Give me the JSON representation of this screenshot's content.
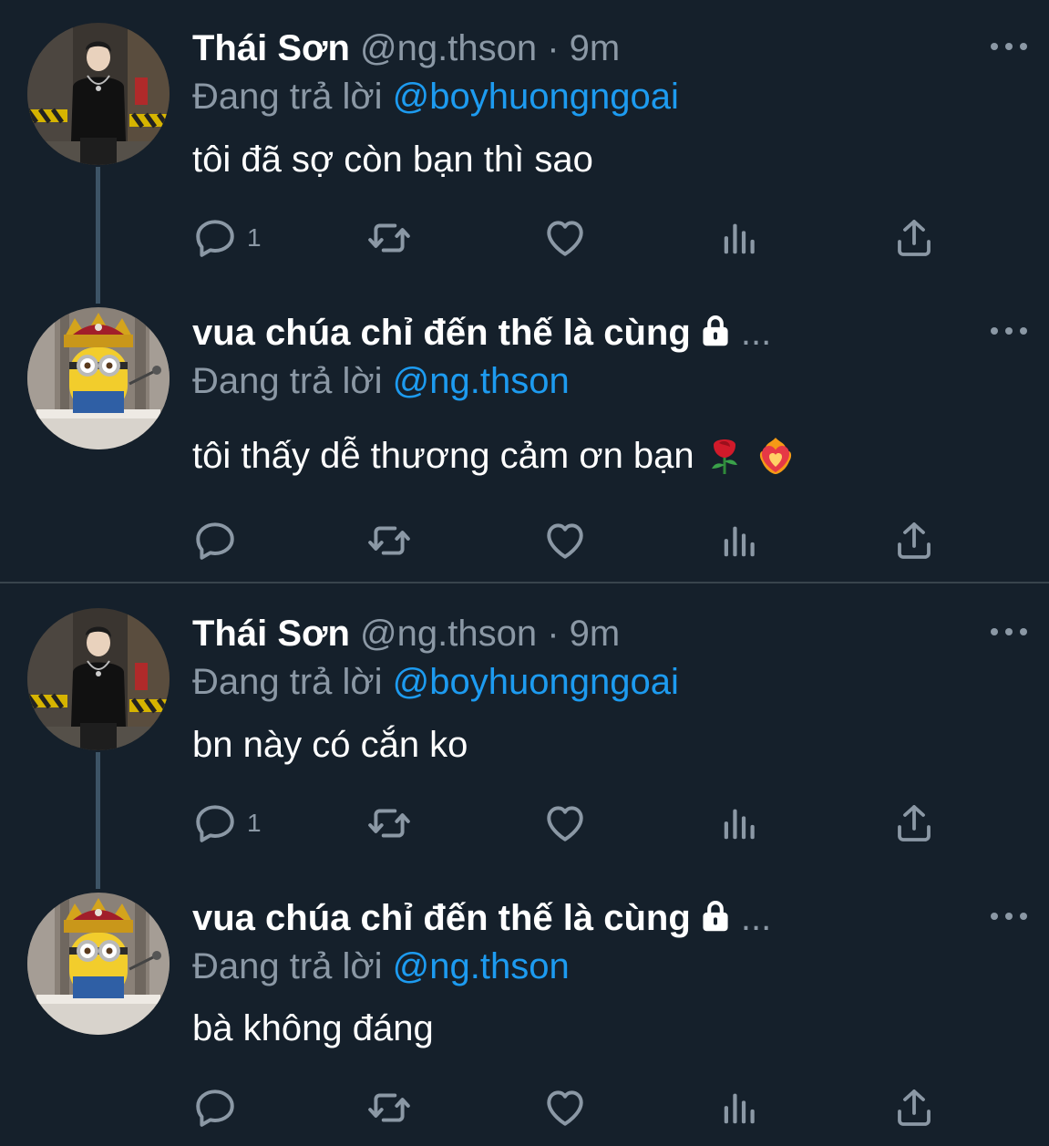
{
  "tweets": [
    {
      "name": "Thái Sơn",
      "handle": "@ng.thson",
      "separator": "·",
      "time": "9m",
      "reply_prefix": "Đang trả lời",
      "reply_to": "@boyhuongngoai",
      "text": "tôi đã sợ còn bạn thì sao",
      "reply_count": "1",
      "avatar": "person-photo"
    },
    {
      "name": "vua chúa chỉ đến thế là cùng",
      "name_suffix": "...",
      "protected_icon": "lock-icon",
      "reply_prefix": "Đang trả lời",
      "reply_to": "@ng.thson",
      "text": "tôi thấy dễ thương cảm ơn bạn",
      "emojis": [
        "rose-emoji",
        "heart-on-fire-emoji"
      ],
      "reply_count": "",
      "avatar": "minion-king-photo"
    },
    {
      "name": "Thái Sơn",
      "handle": "@ng.thson",
      "separator": "·",
      "time": "9m",
      "reply_prefix": "Đang trả lời",
      "reply_to": "@boyhuongngoai",
      "text": "bn này có cắn ko",
      "reply_count": "1",
      "avatar": "person-photo"
    },
    {
      "name": "vua chúa chỉ đến thế là cùng",
      "name_suffix": "...",
      "protected_icon": "lock-icon",
      "reply_prefix": "Đang trả lời",
      "reply_to": "@ng.thson",
      "text": "bà không đáng",
      "reply_count": "",
      "avatar": "minion-king-photo"
    }
  ],
  "icons": [
    "reply-icon",
    "retweet-icon",
    "like-icon",
    "views-icon",
    "share-icon",
    "more-icon"
  ],
  "colors": {
    "background": "#15202b",
    "text": "#ffffff",
    "secondary": "#8b98a5",
    "link": "#1d9bf0",
    "thread_line": "#3d5466",
    "divider": "#38444d"
  }
}
